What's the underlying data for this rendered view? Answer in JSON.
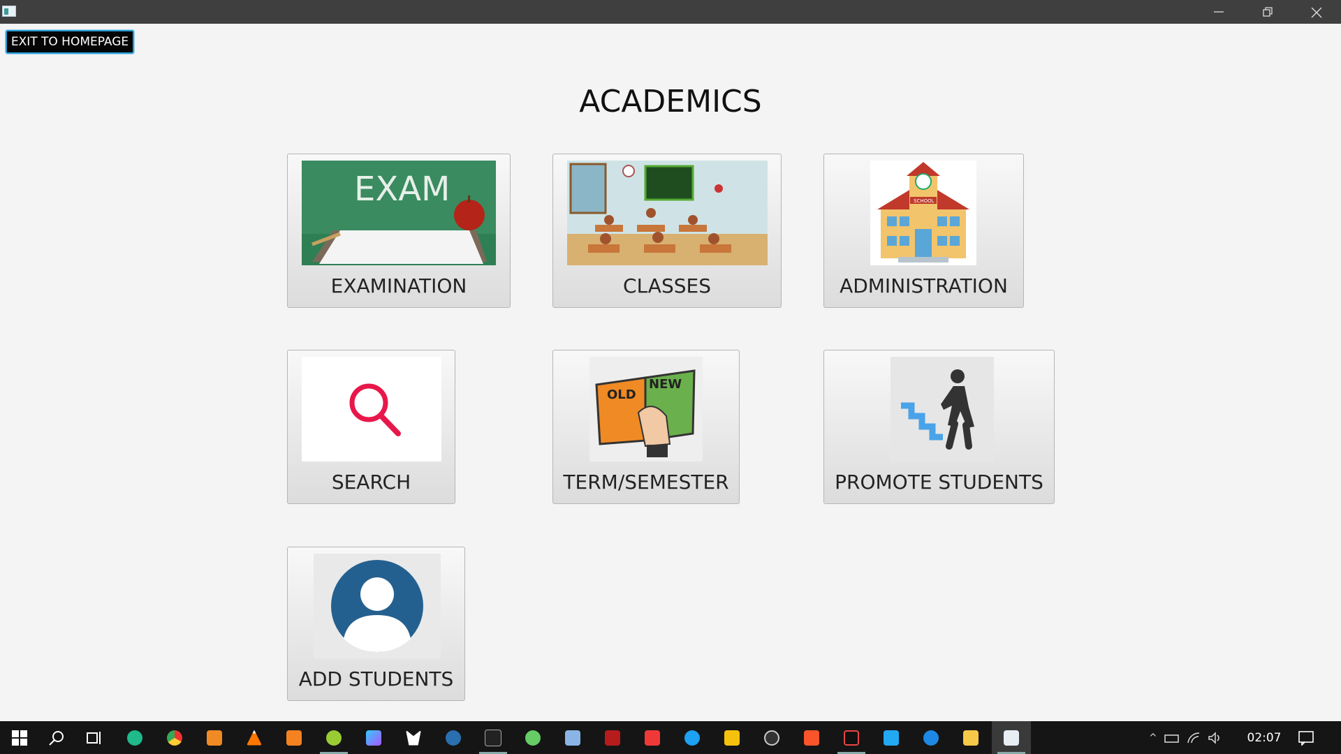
{
  "window": {
    "title": ""
  },
  "toolbar": {
    "exit_label": "EXIT TO HOMEPAGE"
  },
  "page": {
    "title": "ACADEMICS"
  },
  "tiles": [
    {
      "label": "EXAMINATION",
      "image": "exam-chalkboard-image"
    },
    {
      "label": "CLASSES",
      "image": "classroom-image"
    },
    {
      "label": "ADMINISTRATION",
      "image": "school-building-image"
    },
    {
      "label": "SEARCH",
      "image": "magnifier-image"
    },
    {
      "label": "TERM/SEMESTER",
      "image": "old-new-book-image"
    },
    {
      "label": "PROMOTE STUDENTS",
      "image": "stairs-climber-image"
    },
    {
      "label": "ADD STUDENTS",
      "image": "user-avatar-image"
    }
  ],
  "images": {
    "exam_text": "EXAM",
    "school_sign": "SCHOOL",
    "book_old": "OLD",
    "book_new": "NEW"
  },
  "taskbar": {
    "clock": "02:07",
    "apps": [
      "start-icon",
      "search-icon",
      "task-view-icon",
      "gitkraken-icon",
      "chrome-icon",
      "media-player-icon",
      "vlc-icon",
      "sublime-icon",
      "app-icon",
      "app-icon",
      "app-icon",
      "app-icon",
      "terminal-icon",
      "settings-icon",
      "box-icon",
      "filezilla-icon",
      "vivaldi-icon",
      "twitter-icon",
      "slides-icon",
      "obs-icon",
      "brave-icon",
      "intellij-icon",
      "vscode-icon",
      "app-icon",
      "file-explorer-icon",
      "java-app-icon"
    ]
  },
  "colors": {
    "accent": "#2a9fd6",
    "titlebar": "#3f3f3f",
    "taskbar": "#151515",
    "background": "#f4f4f4"
  }
}
